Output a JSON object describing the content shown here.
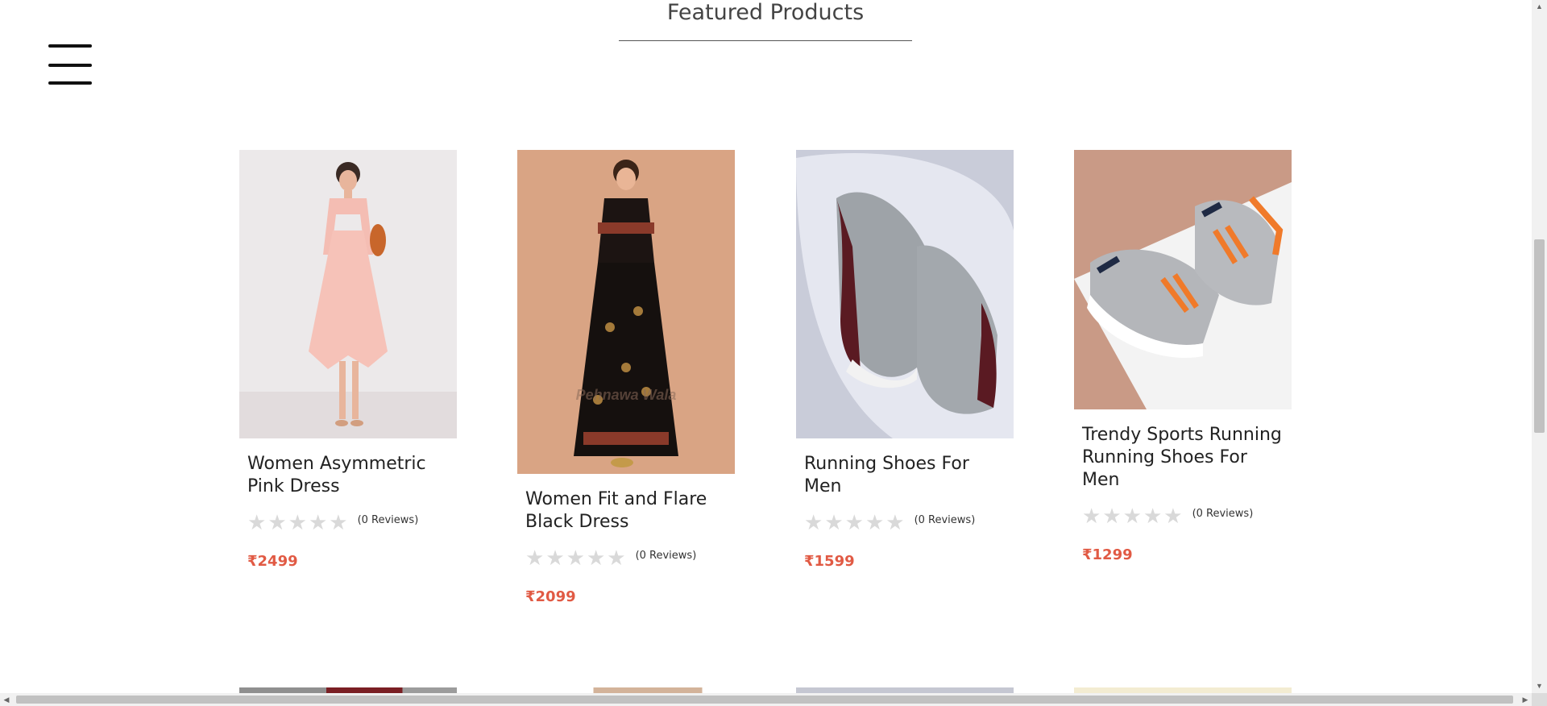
{
  "section": {
    "title": "Featured Products"
  },
  "menu": {
    "icon": "hamburger-menu-icon"
  },
  "star_symbol": "★",
  "products": [
    {
      "name": "Women Asymmetric Pink Dress",
      "reviews": "(0 Reviews)",
      "price": "₹2499",
      "rating": 0
    },
    {
      "name": "Women Fit and Flare Black Dress",
      "reviews": "(0 Reviews)",
      "price": "₹2099",
      "rating": 0,
      "image_watermark": "Pehnawa Wala"
    },
    {
      "name": "Running Shoes For Men",
      "reviews": "(0 Reviews)",
      "price": "₹1599",
      "rating": 0
    },
    {
      "name": "Trendy Sports Running Running Shoes For Men",
      "reviews": "(0 Reviews)",
      "price": "₹1299",
      "rating": 0
    }
  ],
  "colors": {
    "price": "#e15a44",
    "star_empty": "#d9d9d9"
  },
  "scrollbars": {
    "up_arrow": "▲",
    "down_arrow": "▼",
    "left_arrow": "◀",
    "right_arrow": "▶"
  }
}
